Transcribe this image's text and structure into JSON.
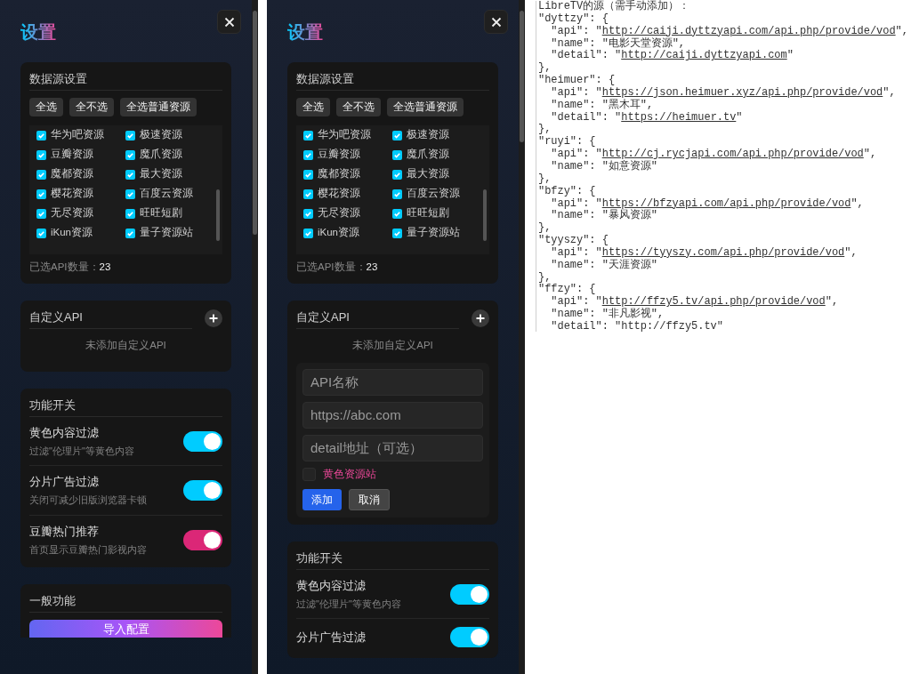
{
  "panels": [
    {
      "title": "设置",
      "sources": {
        "title": "数据源设置",
        "buttons": [
          "全选",
          "全不选",
          "全选普通资源"
        ],
        "items": [
          {
            "label": "华为吧资源",
            "checked": true
          },
          {
            "label": "极速资源",
            "checked": true
          },
          {
            "label": "豆瓣资源",
            "checked": true
          },
          {
            "label": "魔爪资源",
            "checked": true
          },
          {
            "label": "魔都资源",
            "checked": true
          },
          {
            "label": "最大资源",
            "checked": true
          },
          {
            "label": "樱花资源",
            "checked": true
          },
          {
            "label": "百度云资源",
            "checked": true
          },
          {
            "label": "无尽资源",
            "checked": true
          },
          {
            "label": "旺旺短剧",
            "checked": true
          },
          {
            "label": "iKun资源",
            "checked": true
          },
          {
            "label": "量子资源站",
            "checked": true
          }
        ],
        "count_label": "已选API数量：",
        "count": "23"
      },
      "custom_api": {
        "title": "自定义API",
        "empty_text": "未添加自定义API"
      },
      "features": {
        "title": "功能开关",
        "items": [
          {
            "title": "黄色内容过滤",
            "description": "过滤\"伦理片\"等黄色内容",
            "on": true,
            "color": "#00ccff"
          },
          {
            "title": "分片广告过滤",
            "description": "关闭可减少旧版浏览器卡顿",
            "on": true,
            "color": "#00ccff"
          },
          {
            "title": "豆瓣热门推荐",
            "description": "首页显示豆瓣热门影视内容",
            "on": true,
            "color": "#db2777"
          }
        ]
      },
      "general": {
        "title": "一般功能",
        "button": "导入配置"
      }
    },
    {
      "title": "设置",
      "sources": {
        "title": "数据源设置",
        "buttons": [
          "全选",
          "全不选",
          "全选普通资源"
        ],
        "items": [
          {
            "label": "华为吧资源",
            "checked": true
          },
          {
            "label": "极速资源",
            "checked": true
          },
          {
            "label": "豆瓣资源",
            "checked": true
          },
          {
            "label": "魔爪资源",
            "checked": true
          },
          {
            "label": "魔都资源",
            "checked": true
          },
          {
            "label": "最大资源",
            "checked": true
          },
          {
            "label": "樱花资源",
            "checked": true
          },
          {
            "label": "百度云资源",
            "checked": true
          },
          {
            "label": "无尽资源",
            "checked": true
          },
          {
            "label": "旺旺短剧",
            "checked": true
          },
          {
            "label": "iKun资源",
            "checked": true
          },
          {
            "label": "量子资源站",
            "checked": true
          }
        ],
        "count_label": "已选API数量：",
        "count": "23"
      },
      "custom_api": {
        "title": "自定义API",
        "empty_text": "未添加自定义API",
        "form": {
          "fields": [
            {
              "placeholder": "API名称"
            },
            {
              "placeholder": "https://abc.com"
            },
            {
              "placeholder": "detail地址（可选）"
            }
          ],
          "adult": {
            "label": "黄色资源站",
            "checked": false
          },
          "buttons": [
            {
              "label": "添加",
              "kind": "primary"
            },
            {
              "label": "取消",
              "kind": "secondary"
            }
          ]
        }
      },
      "features": {
        "title": "功能开关",
        "items": [
          {
            "title": "黄色内容过滤",
            "description": "过滤\"伦理片\"等黄色内容",
            "on": true,
            "color": "#00ccff"
          },
          {
            "title": "分片广告过滤",
            "on": true,
            "color": "#00ccff"
          }
        ]
      }
    }
  ],
  "code": {
    "lines": [
      {
        "pre": "LibreTV的源（需手动添加）："
      },
      {
        "pre": "\"dyttzy\": {"
      },
      {
        "pre": "  \"api\": \"",
        "link": "http://caiji.dyttzyapi.com/api.php/provide/vod",
        "post": "\","
      },
      {
        "pre": "  \"name\": \"电影天堂资源\","
      },
      {
        "pre": "  \"detail\": \"",
        "link": "http://caiji.dyttzyapi.com",
        "post": "\""
      },
      {
        "pre": "},"
      },
      {
        "pre": "\"heimuer\": {"
      },
      {
        "pre": "  \"api\": \"",
        "link": "https://json.heimuer.xyz/api.php/provide/vod",
        "post": "\","
      },
      {
        "pre": "  \"name\": \"黑木耳\","
      },
      {
        "pre": "  \"detail\": \"",
        "link": "https://heimuer.tv",
        "post": "\""
      },
      {
        "pre": "},"
      },
      {
        "pre": "\"ruyi\": {"
      },
      {
        "pre": "  \"api\": \"",
        "link": "http://cj.rycjapi.com/api.php/provide/vod",
        "post": "\","
      },
      {
        "pre": "  \"name\": \"如意资源\""
      },
      {
        "pre": "},"
      },
      {
        "pre": "\"bfzy\": {"
      },
      {
        "pre": "  \"api\": \"",
        "link": "https://bfzyapi.com/api.php/provide/vod",
        "post": "\","
      },
      {
        "pre": "  \"name\": \"暴风资源\""
      },
      {
        "pre": "},"
      },
      {
        "pre": "\"tyyszy\": {"
      },
      {
        "pre": "  \"api\": \"",
        "link": "https://tyyszy.com/api.php/provide/vod",
        "post": "\","
      },
      {
        "pre": "  \"name\": \"天涯资源\""
      },
      {
        "pre": "},"
      },
      {
        "pre": "\"ffzy\": {"
      },
      {
        "pre": "  \"api\": \"",
        "link": "http://ffzy5.tv/api.php/provide/vod",
        "post": "\","
      },
      {
        "pre": "  \"name\": \"非凡影视\","
      },
      {
        "pre": "  \"detail\": \"http://ffzy5.tv\""
      }
    ]
  }
}
